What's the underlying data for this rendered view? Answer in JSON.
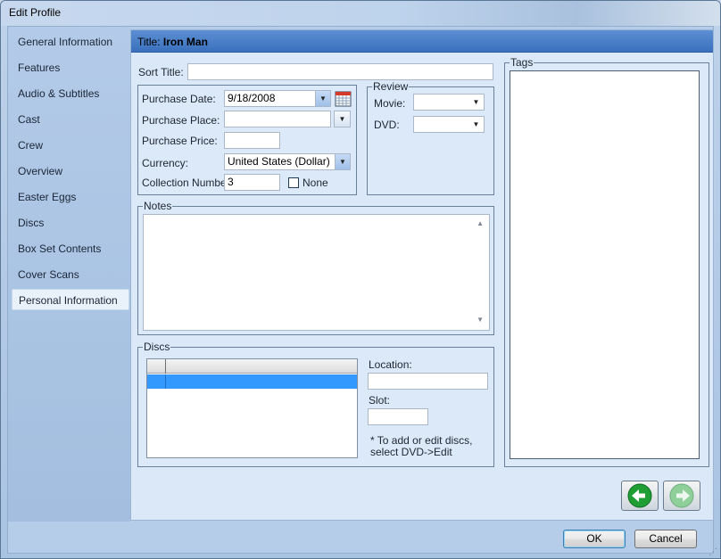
{
  "window": {
    "title": "Edit Profile"
  },
  "sidebar": {
    "items": [
      {
        "label": "General Information",
        "active": false
      },
      {
        "label": "Features",
        "active": false
      },
      {
        "label": "Audio & Subtitles",
        "active": false
      },
      {
        "label": "Cast",
        "active": false
      },
      {
        "label": "Crew",
        "active": false
      },
      {
        "label": "Overview",
        "active": false
      },
      {
        "label": "Easter Eggs",
        "active": false
      },
      {
        "label": "Discs",
        "active": false
      },
      {
        "label": "Box Set Contents",
        "active": false
      },
      {
        "label": "Cover Scans",
        "active": false
      },
      {
        "label": "Personal Information",
        "active": true
      }
    ]
  },
  "header": {
    "title_label": "Title:",
    "title_value": "Iron Man"
  },
  "form": {
    "sort_title_label": "Sort Title:",
    "sort_title_value": "",
    "purchase_date_label": "Purchase Date:",
    "purchase_date_value": "9/18/2008",
    "purchase_place_label": "Purchase Place:",
    "purchase_place_value": "",
    "purchase_price_label": "Purchase Price:",
    "purchase_price_value": "",
    "currency_label": "Currency:",
    "currency_value": "United States (Dollar)",
    "collection_number_label": "Collection Number:",
    "collection_number_value": "3",
    "none_label": "None",
    "none_checked": false
  },
  "review": {
    "title": "Review",
    "movie_label": "Movie:",
    "movie_value": "",
    "dvd_label": "DVD:",
    "dvd_value": ""
  },
  "notes": {
    "title": "Notes",
    "value": ""
  },
  "discs": {
    "title": "Discs",
    "location_label": "Location:",
    "location_value": "",
    "slot_label": "Slot:",
    "slot_value": "",
    "hint": "* To add or edit discs, select DVD->Edit"
  },
  "tags": {
    "title": "Tags"
  },
  "buttons": {
    "ok": "OK",
    "cancel": "Cancel"
  },
  "icons": {
    "calendar": "calendar-icon",
    "back": "back-arrow-icon",
    "forward": "forward-arrow-icon",
    "dropdown": "chevron-down-icon"
  },
  "colors": {
    "accent_header": "#3a70bd",
    "selected_row": "#3399ff",
    "nav_green": "#1e9e35",
    "nav_green_disabled": "#8fcf9a"
  }
}
